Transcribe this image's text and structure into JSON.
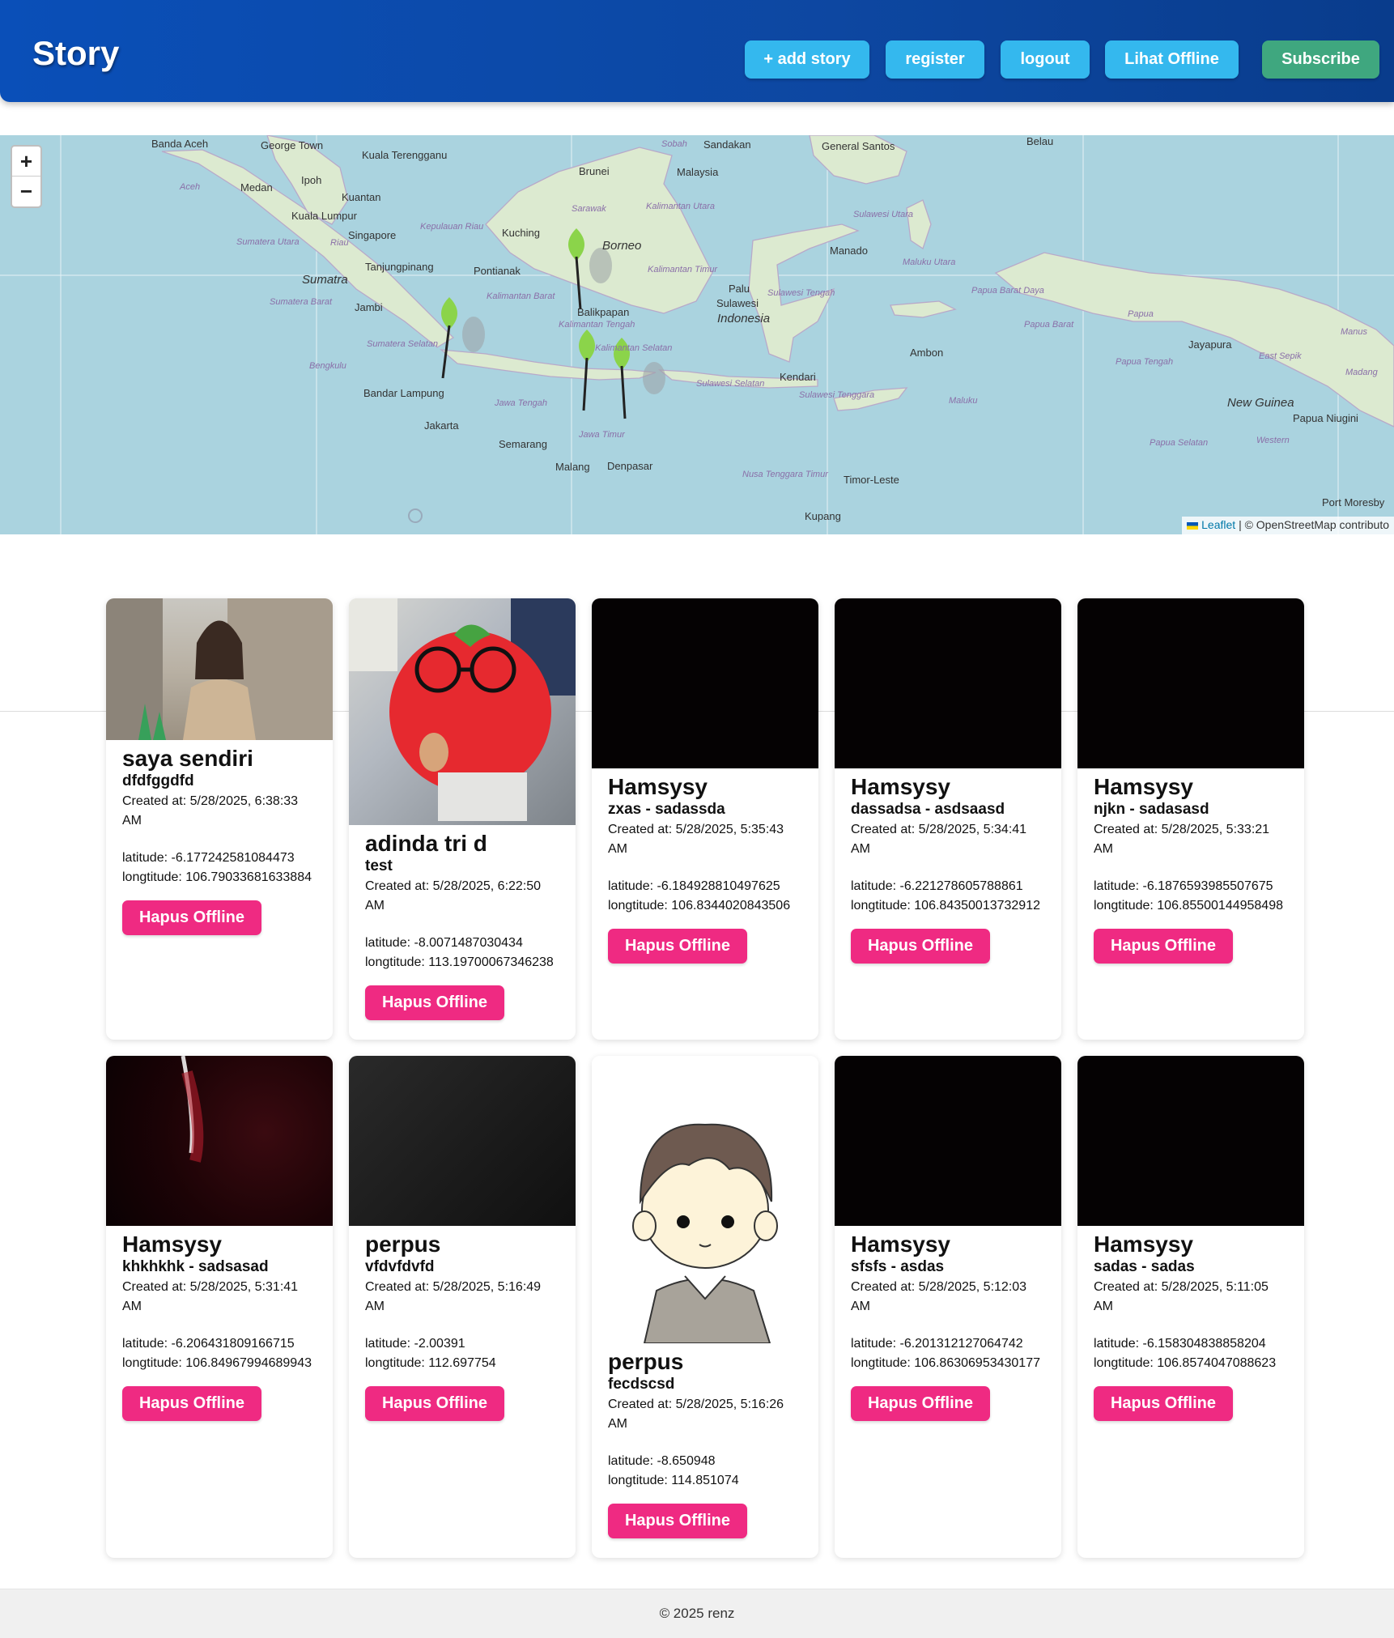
{
  "header": {
    "brand": "Story",
    "nav": [
      {
        "label": "+ add story",
        "color": "#34b8ee"
      },
      {
        "label": "register",
        "color": "#34b8ee"
      },
      {
        "label": "logout",
        "color": "#34b8ee"
      },
      {
        "label": "Lihat Offline",
        "color": "#34b8ee"
      },
      {
        "label": "Subscribe",
        "color": "#3fa77f"
      }
    ]
  },
  "map": {
    "zoom_in": "+",
    "zoom_out": "−",
    "attribution_link": "Leaflet",
    "attribution_text": "| © OpenStreetMap contributo",
    "labels": [
      "Banda Aceh",
      "George Town",
      "Kuala Terengganu",
      "Sobah",
      "Sandakan",
      "General Santos",
      "Belau",
      "Medan",
      "Ipoh",
      "Brunei",
      "Malaysia",
      "Aceh",
      "Kuantan",
      "Kuala Lumpur",
      "Kalimantan Utara",
      "Sarawak",
      "Sulawesi Utara",
      "Singapore",
      "Kepulauan Riau",
      "Kuching",
      "Borneo",
      "Manado",
      "Sumatera Utara",
      "Riau",
      "Tanjungpinang",
      "Pontianak",
      "Kalimantan Timur",
      "Maluku Utara",
      "Sumatra",
      "Kalimantan Barat",
      "Palu",
      "Papua Barat Daya",
      "Jambi",
      "Balikpapan",
      "Sulawesi Tengah",
      "Sulawesi",
      "Indonesia",
      "Sumatera Barat",
      "Kalimantan Tengah",
      "Papua Barat",
      "Papua",
      "Jayapura",
      "Sumatera Selatan",
      "Kalimantan Selatan",
      "Ambon",
      "Papua Tengah",
      "East Sepik",
      "Manus",
      "Bengkulu",
      "Kendari",
      "Madang",
      "Bandar Lampung",
      "Sulawesi Selatan",
      "Sulawesi Tenggara",
      "Maluku",
      "New Guinea",
      "Jawa Tengah",
      "Jakarta",
      "Papua Niugini",
      "Semarang",
      "Jawa Timur",
      "Papua Selatan",
      "Western",
      "Malang",
      "Denpasar",
      "Nusa Tenggara Timur",
      "Timor-Leste",
      "Kupang",
      "Port Moresby"
    ]
  },
  "stories": [
    {
      "name": "saya sendiri",
      "desc": "dfdfggdfd",
      "created": "Created at: 5/28/2025, 6:38:33 AM",
      "lat": "latitude: -6.177242581084473",
      "lon": "longtitude: 106.79033681633884",
      "button": "Hapus Offline",
      "photo": "woman-street-photo"
    },
    {
      "name": "adinda tri d",
      "desc": "test",
      "created": "Created at: 5/28/2025, 6:22:50 AM",
      "lat": "latitude: -8.0071487030434",
      "lon": "longtitude: 113.19700067346238",
      "button": "Hapus Offline",
      "photo": "tomato-plush-photo"
    },
    {
      "name": "Hamsysy",
      "desc": "zxas - sadassda",
      "created": "Created at: 5/28/2025, 5:35:43 AM",
      "lat": "latitude: -6.184928810497625",
      "lon": "longtitude: 106.8344020843506",
      "button": "Hapus Offline",
      "photo": "dark-photo"
    },
    {
      "name": "Hamsysy",
      "desc": "dassadsa - asdsaasd",
      "created": "Created at: 5/28/2025, 5:34:41 AM",
      "lat": "latitude: -6.221278605788861",
      "lon": "longtitude: 106.84350013732912",
      "button": "Hapus Offline",
      "photo": "dark-photo"
    },
    {
      "name": "Hamsysy",
      "desc": "njkn - sadasasd",
      "created": "Created at: 5/28/2025, 5:33:21 AM",
      "lat": "latitude: -6.1876593985507675",
      "lon": "longtitude: 106.85500144958498",
      "button": "Hapus Offline",
      "photo": "dark-photo"
    },
    {
      "name": "Hamsysy",
      "desc": "khkhkhk - sadsasad",
      "created": "Created at: 5/28/2025, 5:31:41 AM",
      "lat": "latitude: -6.206431809166715",
      "lon": "longtitude: 106.84967994689943",
      "button": "Hapus Offline",
      "photo": "dark-red-photo"
    },
    {
      "name": "perpus",
      "desc": "vfdvfdvfd",
      "created": "Created at: 5/28/2025, 5:16:49 AM",
      "lat": "latitude: -2.00391",
      "lon": "longtitude: 112.697754",
      "button": "Hapus Offline",
      "photo": "dark-gray-photo"
    },
    {
      "name": "perpus",
      "desc": "fecdscsd",
      "created": "Created at: 5/28/2025, 5:16:26 AM",
      "lat": "latitude: -8.650948",
      "lon": "longtitude: 114.851074",
      "button": "Hapus Offline",
      "photo": "cartoon-boy-image"
    },
    {
      "name": "Hamsysy",
      "desc": "sfsfs - asdas",
      "created": "Created at: 5/28/2025, 5:12:03 AM",
      "lat": "latitude: -6.201312127064742",
      "lon": "longtitude: 106.86306953430177",
      "button": "Hapus Offline",
      "photo": "dark-photo"
    },
    {
      "name": "Hamsysy",
      "desc": "sadas - sadas",
      "created": "Created at: 5/28/2025, 5:11:05 AM",
      "lat": "latitude: -6.158304838858204",
      "lon": "longtitude: 106.8574047088623",
      "button": "Hapus Offline",
      "photo": "dark-photo"
    }
  ],
  "footer": "© 2025 renz"
}
